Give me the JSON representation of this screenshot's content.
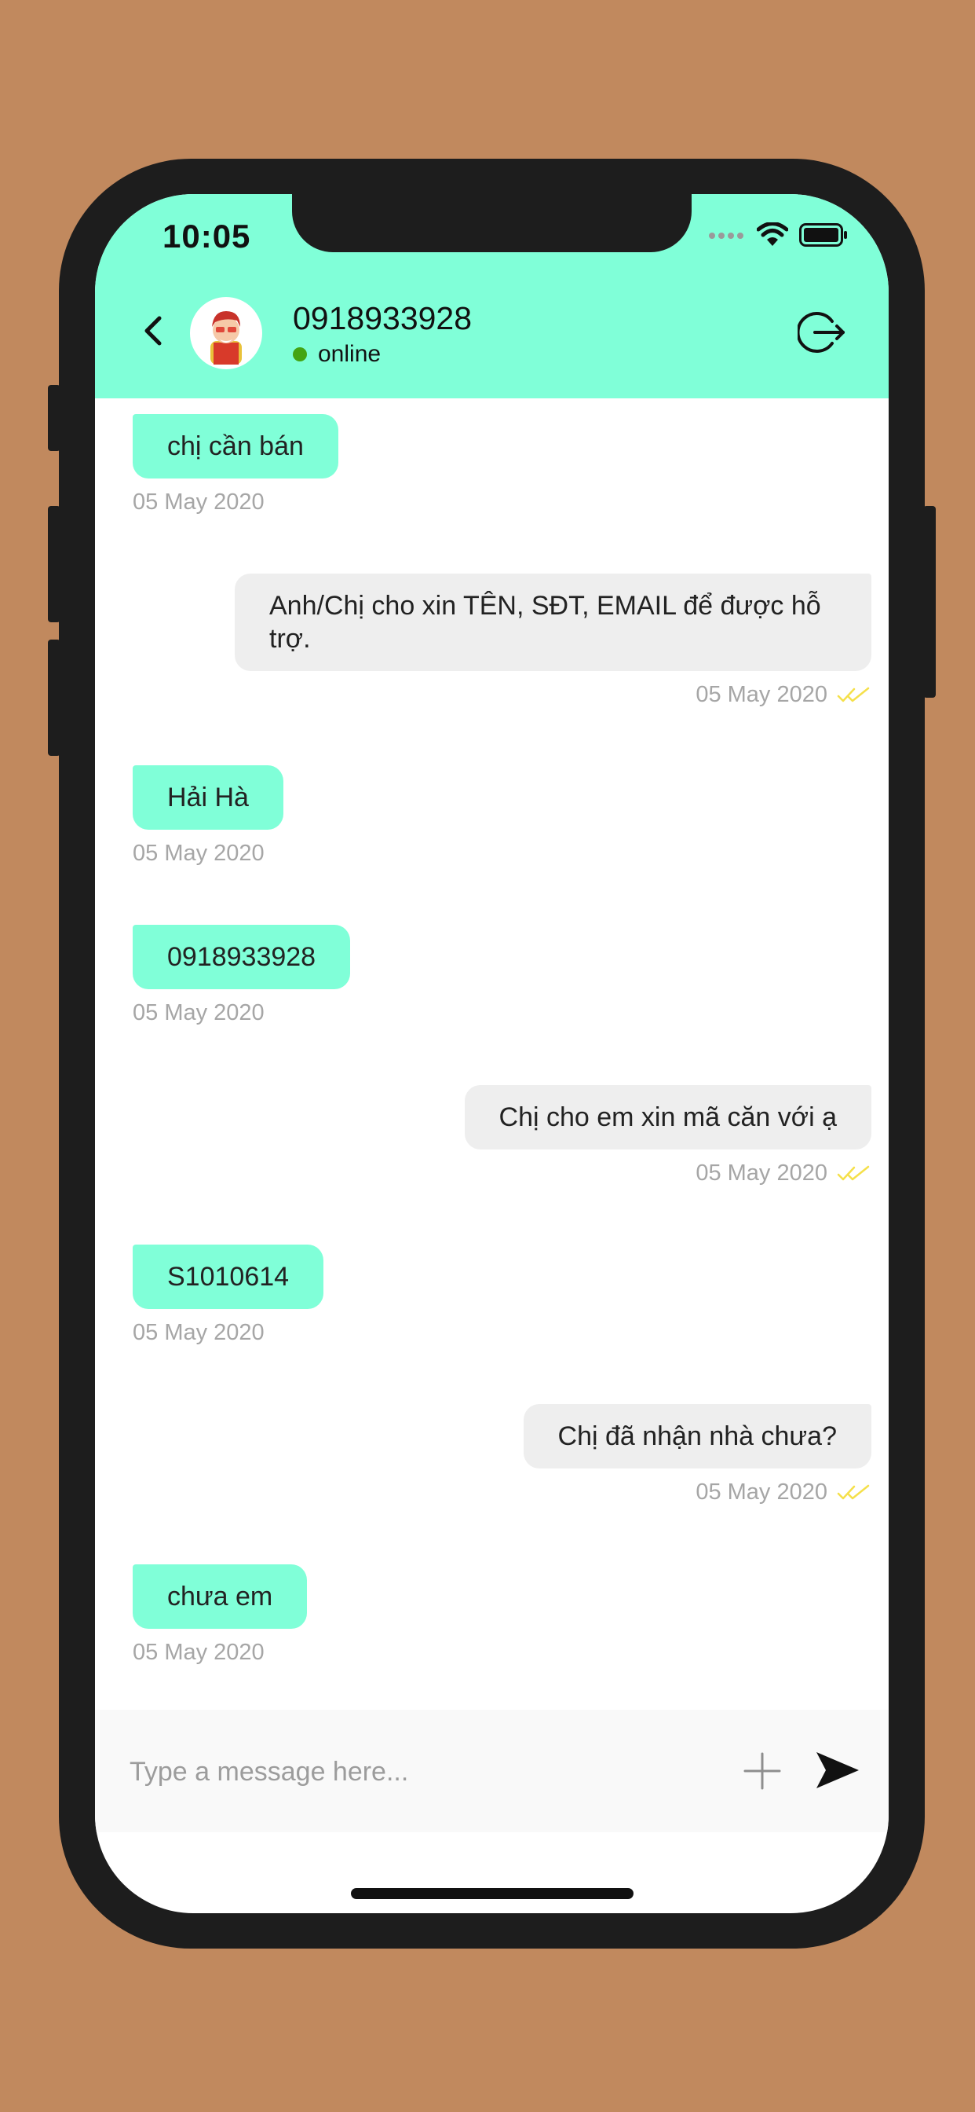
{
  "status_bar": {
    "time": "10:05"
  },
  "header": {
    "contact_name": "0918933928",
    "status": "online",
    "colors": {
      "header_bg": "#80ffd8",
      "online_dot": "#44a413"
    }
  },
  "messages": [
    {
      "direction": "in",
      "text": "chị cần bán",
      "date": "05 May 2020"
    },
    {
      "direction": "out",
      "text": "Anh/Chị cho xin TÊN, SĐT, EMAIL để được hỗ trợ.",
      "date": "05 May 2020",
      "read": true
    },
    {
      "direction": "in",
      "text": "Hải Hà",
      "date": "05 May 2020"
    },
    {
      "direction": "in",
      "text": "0918933928",
      "date": "05 May 2020"
    },
    {
      "direction": "out",
      "text": "Chị cho em xin mã căn với ạ",
      "date": "05 May 2020",
      "read": true
    },
    {
      "direction": "in",
      "text": "S1010614",
      "date": "05 May 2020"
    },
    {
      "direction": "out",
      "text": "Chị đã nhận nhà chưa?",
      "date": "05 May 2020",
      "read": true
    },
    {
      "direction": "in",
      "text": "chưa em",
      "date": "05 May 2020"
    }
  ],
  "composer": {
    "placeholder": "Type a message here..."
  },
  "icons": {
    "back": "chevron-left-icon",
    "logout": "logout-icon",
    "attach": "plus-icon",
    "send": "send-icon",
    "read_receipt": "double-check-icon"
  },
  "colors": {
    "background": "#c1895e",
    "incoming_bubble": "#80ffd8",
    "outgoing_bubble": "#eeeeee",
    "read_check": "#f5e04a"
  }
}
